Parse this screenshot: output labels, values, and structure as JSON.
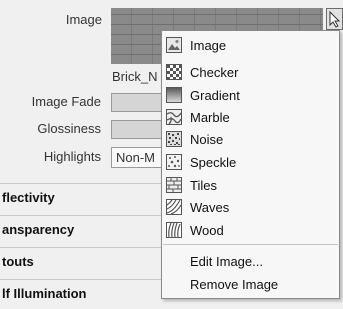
{
  "panel": {
    "image_label": "Image",
    "image_file": "Brick_N",
    "image_fade_label": "Image Fade",
    "glossiness_label": "Glossiness",
    "highlights_label": "Highlights",
    "highlights_value": "Non-M"
  },
  "sections": [
    "flectivity",
    "ansparency",
    "touts",
    "lf Illumination"
  ],
  "menu": {
    "items": [
      {
        "label": "Image",
        "icon": "image-icon"
      },
      {
        "label": "Checker",
        "icon": "checker-icon"
      },
      {
        "label": "Gradient",
        "icon": "gradient-icon"
      },
      {
        "label": "Marble",
        "icon": "marble-icon"
      },
      {
        "label": "Noise",
        "icon": "noise-icon"
      },
      {
        "label": "Speckle",
        "icon": "speckle-icon"
      },
      {
        "label": "Tiles",
        "icon": "tiles-icon"
      },
      {
        "label": "Waves",
        "icon": "waves-icon"
      },
      {
        "label": "Wood",
        "icon": "wood-icon"
      }
    ],
    "actions": [
      {
        "label": "Edit Image..."
      },
      {
        "label": "Remove Image"
      }
    ]
  }
}
